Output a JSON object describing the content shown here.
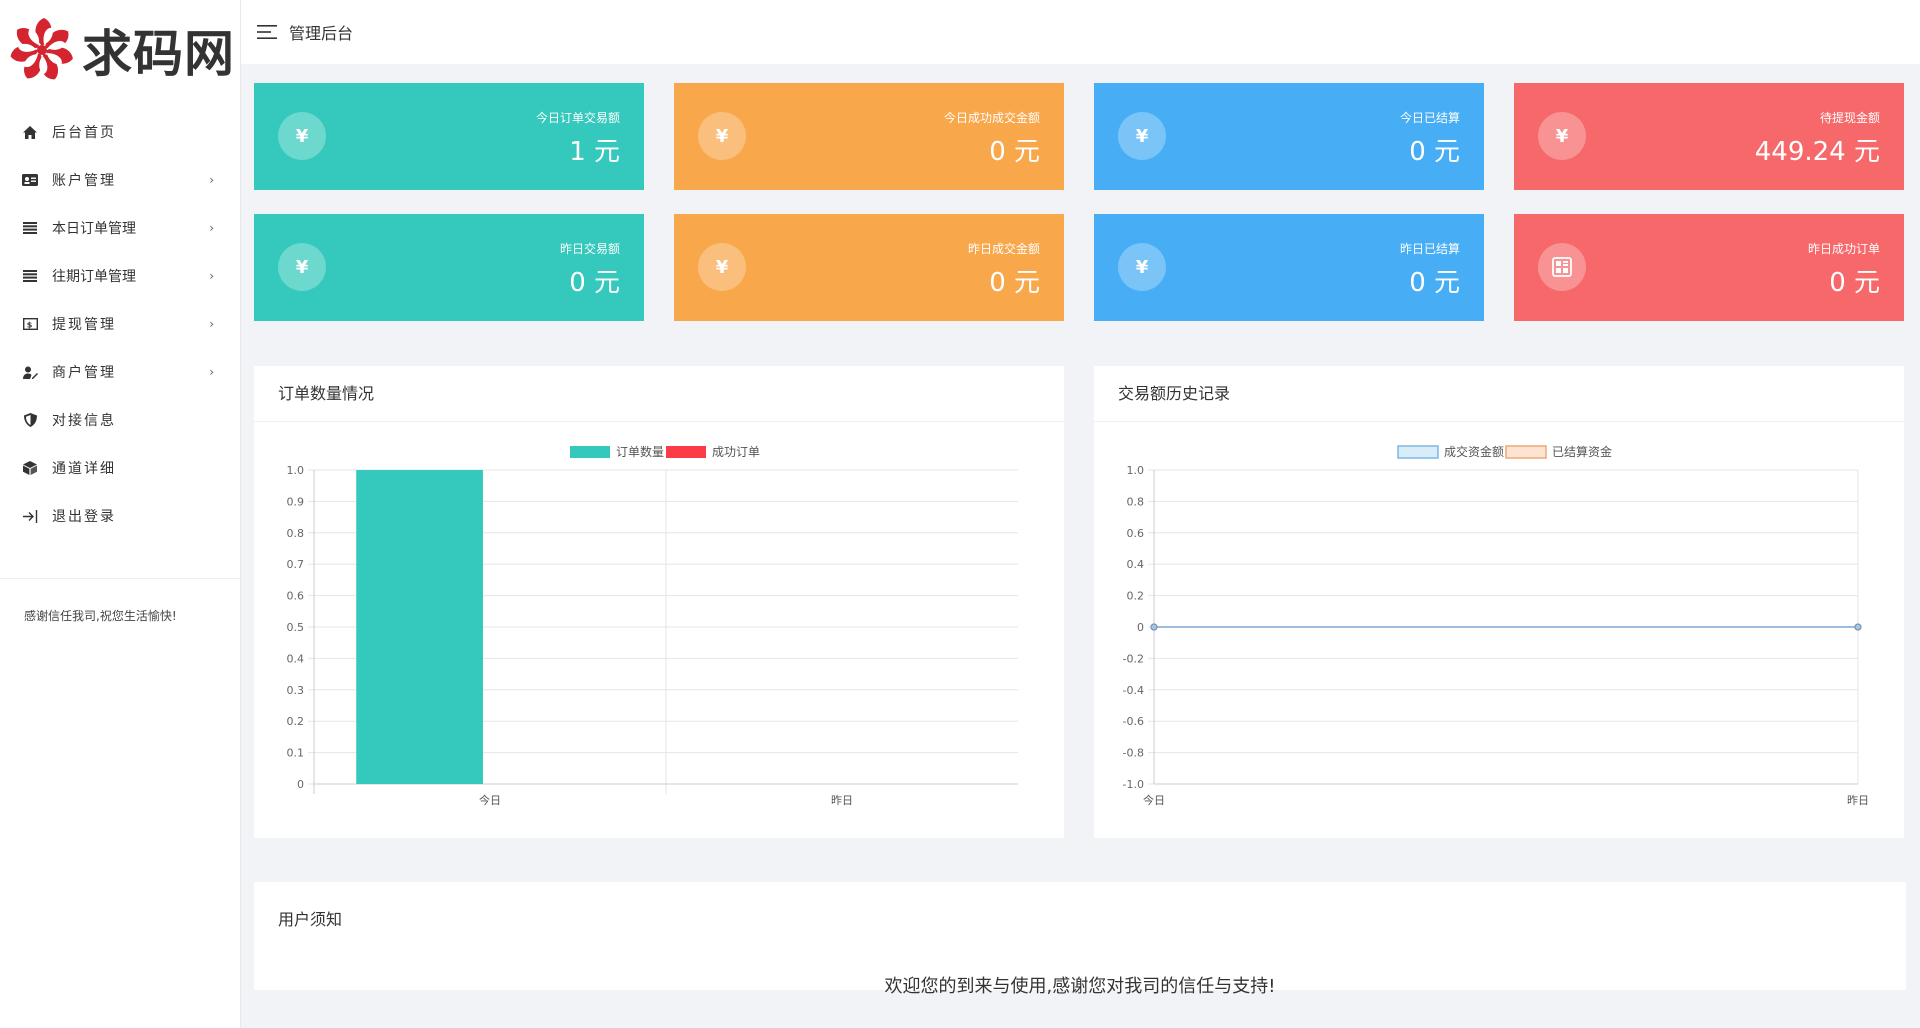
{
  "logo": {
    "text": "求码网"
  },
  "sidebar": {
    "items": [
      {
        "label": "后台首页",
        "icon": "home-icon",
        "has_submenu": false
      },
      {
        "label": "账户管理",
        "icon": "id-card-icon",
        "has_submenu": true
      },
      {
        "label": "本日订单管理",
        "icon": "list-icon",
        "has_submenu": true
      },
      {
        "label": "往期订单管理",
        "icon": "list-icon",
        "has_submenu": true
      },
      {
        "label": "提现管理",
        "icon": "money-icon",
        "has_submenu": true
      },
      {
        "label": "商户管理",
        "icon": "user-edit-icon",
        "has_submenu": true
      },
      {
        "label": "对接信息",
        "icon": "shield-icon",
        "has_submenu": false
      },
      {
        "label": "通道详细",
        "icon": "cube-icon",
        "has_submenu": false
      },
      {
        "label": "退出登录",
        "icon": "logout-icon",
        "has_submenu": false
      }
    ],
    "chevron": "›",
    "note": "感谢信任我司,祝您生活愉快!"
  },
  "header": {
    "title": "管理后台"
  },
  "stats": [
    {
      "label": "今日订单交易额",
      "value": "1 元",
      "icon": "¥",
      "color": "#34c9bc"
    },
    {
      "label": "今日成功成交金额",
      "value": "0 元",
      "icon": "¥",
      "color": "#f9a74b"
    },
    {
      "label": "今日已结算",
      "value": "0 元",
      "icon": "¥",
      "color": "#47aef5"
    },
    {
      "label": "待提现金额",
      "value": "449.24 元",
      "icon": "¥",
      "color": "#f7686a"
    },
    {
      "label": "昨日交易额",
      "value": "0 元",
      "icon": "¥",
      "color": "#34c9bc"
    },
    {
      "label": "昨日成交金额",
      "value": "0 元",
      "icon": "¥",
      "color": "#f9a74b"
    },
    {
      "label": "昨日已结算",
      "value": "0 元",
      "icon": "¥",
      "color": "#47aef5"
    },
    {
      "label": "昨日成功订单",
      "value": "0 元",
      "icon": "calculator-icon",
      "color": "#f7686a"
    }
  ],
  "panels": {
    "orders_title": "订单数量情况",
    "trade_title": "交易额历史记录",
    "notice_title": "用户须知",
    "notice_message": "欢迎您的到来与使用,感谢您对我司的信任与支持!"
  },
  "chart_data": [
    {
      "type": "bar",
      "title": "订单数量情况",
      "categories": [
        "今日",
        "昨日"
      ],
      "series": [
        {
          "name": "订单数量",
          "values": [
            1,
            0
          ],
          "color": "#34c9bc"
        },
        {
          "name": "成功订单",
          "values": [
            0,
            0
          ],
          "color": "#fb3c47"
        }
      ],
      "ylim": [
        0,
        1.0
      ],
      "yticks": [
        "0",
        "0.1",
        "0.2",
        "0.3",
        "0.4",
        "0.5",
        "0.6",
        "0.7",
        "0.8",
        "0.9",
        "1.0"
      ],
      "grid": true,
      "legend": "top-center"
    },
    {
      "type": "line",
      "title": "交易额历史记录",
      "categories": [
        "今日",
        "昨日"
      ],
      "series": [
        {
          "name": "成交资金额",
          "values": [
            0,
            0
          ],
          "color": "#7eb6e6",
          "fill": "#d9ecf9"
        },
        {
          "name": "已结算资金",
          "values": [
            0,
            0
          ],
          "color": "#f0a878",
          "fill": "#fde3d2"
        }
      ],
      "ylim": [
        -1.0,
        1.0
      ],
      "yticks": [
        "-1.0",
        "-0.8",
        "-0.6",
        "-0.4",
        "-0.2",
        "0",
        "0.2",
        "0.4",
        "0.6",
        "0.8",
        "1.0"
      ],
      "grid": true,
      "legend": "top-center"
    }
  ]
}
